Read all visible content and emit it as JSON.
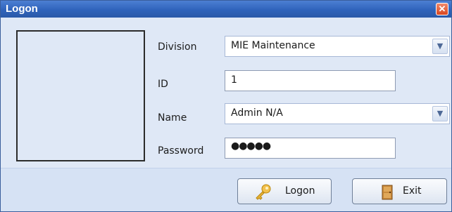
{
  "window": {
    "title": "Logon"
  },
  "form": {
    "division": {
      "label": "Division",
      "value": "MIE Maintenance"
    },
    "id": {
      "label": "ID",
      "value": "1"
    },
    "name": {
      "label": "Name",
      "value": "Admin N/A"
    },
    "password": {
      "label": "Password",
      "masked_value": "●●●●●"
    }
  },
  "buttons": {
    "logon_label": "Logon",
    "exit_label": "Exit"
  },
  "icons": {
    "close": "close-icon",
    "combo_arrow": "chevron-down-icon",
    "logon": "key-icon",
    "exit": "door-icon"
  },
  "colors": {
    "titlebar": "#2f63bb",
    "background": "#dfe8f6",
    "close_button": "#d9461f"
  }
}
